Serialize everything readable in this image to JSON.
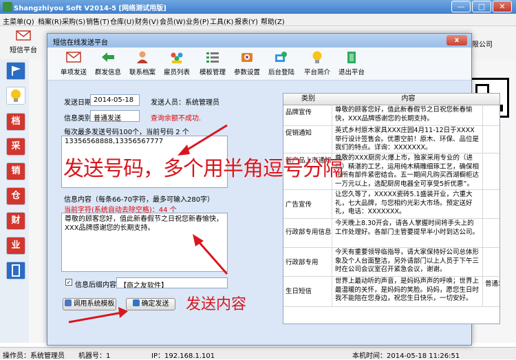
{
  "app": {
    "title": "Shangzhiyou Soft V2014-5 [网络测试用版]",
    "minimize": "—",
    "maximize": "□",
    "close": "✕"
  },
  "menu": [
    "主菜单(Q)",
    "档案(R)",
    "采购(S)",
    "销售(T)",
    "仓库(U)",
    "财务(V)",
    "会员(W)",
    "业务(P)",
    "工具(K)",
    "报表(Y)",
    "帮助(Z)"
  ],
  "main_toolbar": {
    "sms_label": "短信平台",
    "company": "限公司"
  },
  "sidebar_chars": [
    "档",
    "采",
    "销",
    "仓",
    "财",
    "业"
  ],
  "status_bar": {
    "operator": "操作员：系统管理员",
    "machine": "机器号：1",
    "ip": "IP：192.168.1.101",
    "local_time": "本机时间：2014-05-18 11:26:51"
  },
  "dialog": {
    "title": "短信在线发送平台",
    "close": "x",
    "toolbar": [
      {
        "label": "单项发送",
        "icon": "sms-envelope-icon"
      },
      {
        "label": "群发信息",
        "icon": "green-arrow-icon"
      },
      {
        "label": "联系档案",
        "icon": "contact-person-icon"
      },
      {
        "label": "雇员列表",
        "icon": "employees-icon"
      },
      {
        "label": "模板管理",
        "icon": "template-list-icon"
      },
      {
        "label": "参数设置",
        "icon": "settings-gear-icon"
      },
      {
        "label": "后台登陆",
        "icon": "backend-login-icon"
      },
      {
        "label": "平台简介",
        "icon": "lightbulb-icon"
      },
      {
        "label": "退出平台",
        "icon": "exit-icon"
      }
    ],
    "form": {
      "send_date_label": "发送日期",
      "send_date_value": "2014-05-18",
      "sender_label": "发送人员：系统管理员",
      "category_label": "信息类别",
      "category_value": "普通发送",
      "query_status": "查询余额不成功.",
      "recipients_hint": "每次最多发送号码100个，当前号码 2 个",
      "recipients_value": "13356568888,13356567777",
      "content_hint": "信息内容（每条66-70字符，最多可输入280字）",
      "char_count": "当前字符(系统自动去除空格)：44 个",
      "content_value": "尊敬的顾客您好，值此新春假节之日祝您新春愉快，XXX品牌感谢您的长期支持。",
      "suffix_checkbox_label": "信息后缀内容",
      "suffix_value": "【商之友软件】",
      "template_button": "调用系统模板",
      "send_button": "确定发送"
    },
    "table": {
      "headers": [
        "类别",
        "内容"
      ],
      "rows": [
        {
          "category": "品牌宣传",
          "content": "尊敬的顾客您好，值此新春假节之日祝您新春愉快，XXX品牌感谢您的长期支持。",
          "extra": ""
        },
        {
          "category": "促销通知",
          "content": "英式乡村原木家具XXX庄园4月11-12日于XXXX举行设计签售会。优惠空前！原木、环保、品位是我们的特点。详询：XXXXXXX。",
          "extra": ""
        },
        {
          "category": "新产品上市通知",
          "content": "尊敬的XXX厨房火爆上市，独家采用专业的（进口）精湛的工艺，运用纯木精雕细琢工艺，确保相伍所有部件紧密结合。五一期间凡购买西湖橱柜达一万元以上，选配厨房电器全可享受5折优惠”。",
          "extra": ""
        },
        {
          "category": "广告宣传",
          "content": "让您久等了，XXXXX瓷砖5.1盛装开业，六重大礼，七大品牌，与您相约光彩大市场。预定送好礼，电话：XXXXXXX。",
          "extra": ""
        },
        {
          "category": "行政部专用信息",
          "content": "今天晚上8.30开会，请各人掌握时间将手头上的工作处理好。各部门主管要提早半小时到达公司。",
          "extra": ""
        },
        {
          "category": "行政部专用",
          "content": "今天有重要领导临指导，请大家保持好公司总体形象及个人台面整洁，另外请部门以上人员于下午三时在公司会议室召开紧急会议，谢谢。",
          "extra": ""
        },
        {
          "category": "生日短信",
          "content": "世界上最动听的声音，是妈妈声声的呼唤；世界上最温暖的关怀，是妈妈的笑脸。妈妈，愿您生日时我不能陪在您身边，祝您生日快乐，一切安好。",
          "extra": "普通发"
        }
      ]
    }
  },
  "annotations": {
    "number_hint": "发送号码，多个用半角逗号分隔",
    "content_hint": "发送内容"
  },
  "colors": {
    "title_bar": "#4f8ed6",
    "dialog_bg": "#dbe7f6",
    "annotation_red": "#d9161e",
    "status_red": "#e00000",
    "sidebar_red": "#d3362d"
  }
}
